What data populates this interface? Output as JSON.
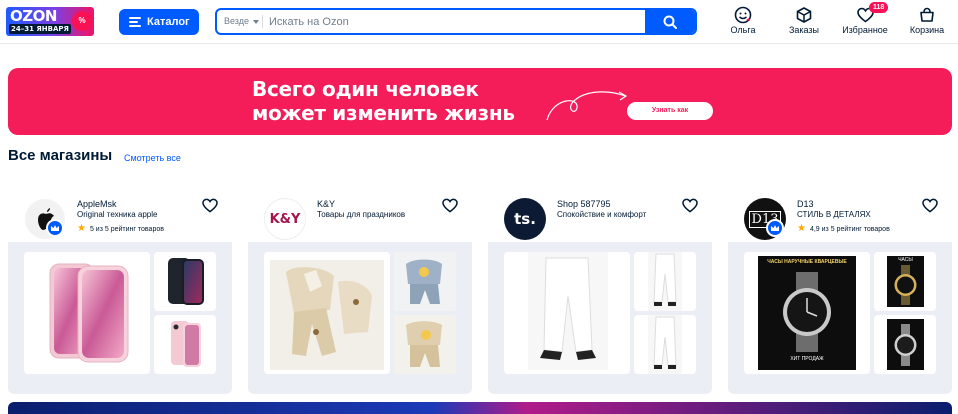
{
  "header": {
    "logo": {
      "brand": "OZON",
      "dates": "24–31 ЯНВАРЯ",
      "sale": "%"
    },
    "catalog_label": "Каталог",
    "search": {
      "scope": "Везде",
      "placeholder": "Искать на Ozon"
    },
    "nav": [
      {
        "label": "Ольга",
        "icon": "profile-icon"
      },
      {
        "label": "Заказы",
        "icon": "box-icon"
      },
      {
        "label": "Избранное",
        "icon": "heart-icon",
        "badge": "118"
      },
      {
        "label": "Корзина",
        "icon": "cart-icon"
      }
    ]
  },
  "banner": {
    "line1": "Всего один человек",
    "line2": "может изменить жизнь",
    "cta": "Узнать как",
    "color": "#f51c5a"
  },
  "section": {
    "title": "Все магазины",
    "see_all": "Смотреть все"
  },
  "stores": [
    {
      "name": "AppleMsk",
      "tagline": "Original техника apple",
      "rating": "5 из 5 рейтинг товаров",
      "has_rating": true,
      "avatar": "apple-logo"
    },
    {
      "name": "K&Y",
      "tagline": "Товары для праздников",
      "rating": "",
      "has_rating": false,
      "avatar": "ky-logo",
      "avatar_text": "K&Y"
    },
    {
      "name": "Shop 587795",
      "tagline": "Спокойствие и комфорт",
      "rating": "",
      "has_rating": false,
      "avatar": "ts-logo",
      "avatar_text": "ts."
    },
    {
      "name": "D13",
      "tagline": "СТИЛЬ В ДЕТАЛЯХ",
      "rating": "4,9 из 5 рейтинг товаров",
      "has_rating": true,
      "avatar": "d13-logo",
      "avatar_text": "D13"
    }
  ],
  "product_texts": {
    "watch_big_top": "ЧАСЫ НАРУЧНЫЕ КВАРЦЕВЫЕ",
    "watch_big_bottom": "ХИТ ПРОДАЖ",
    "watch_small": "ЧАСЫ"
  },
  "colors": {
    "accent": "#005bff",
    "badge": "#f91155",
    "rating_star": "#ffa800"
  }
}
